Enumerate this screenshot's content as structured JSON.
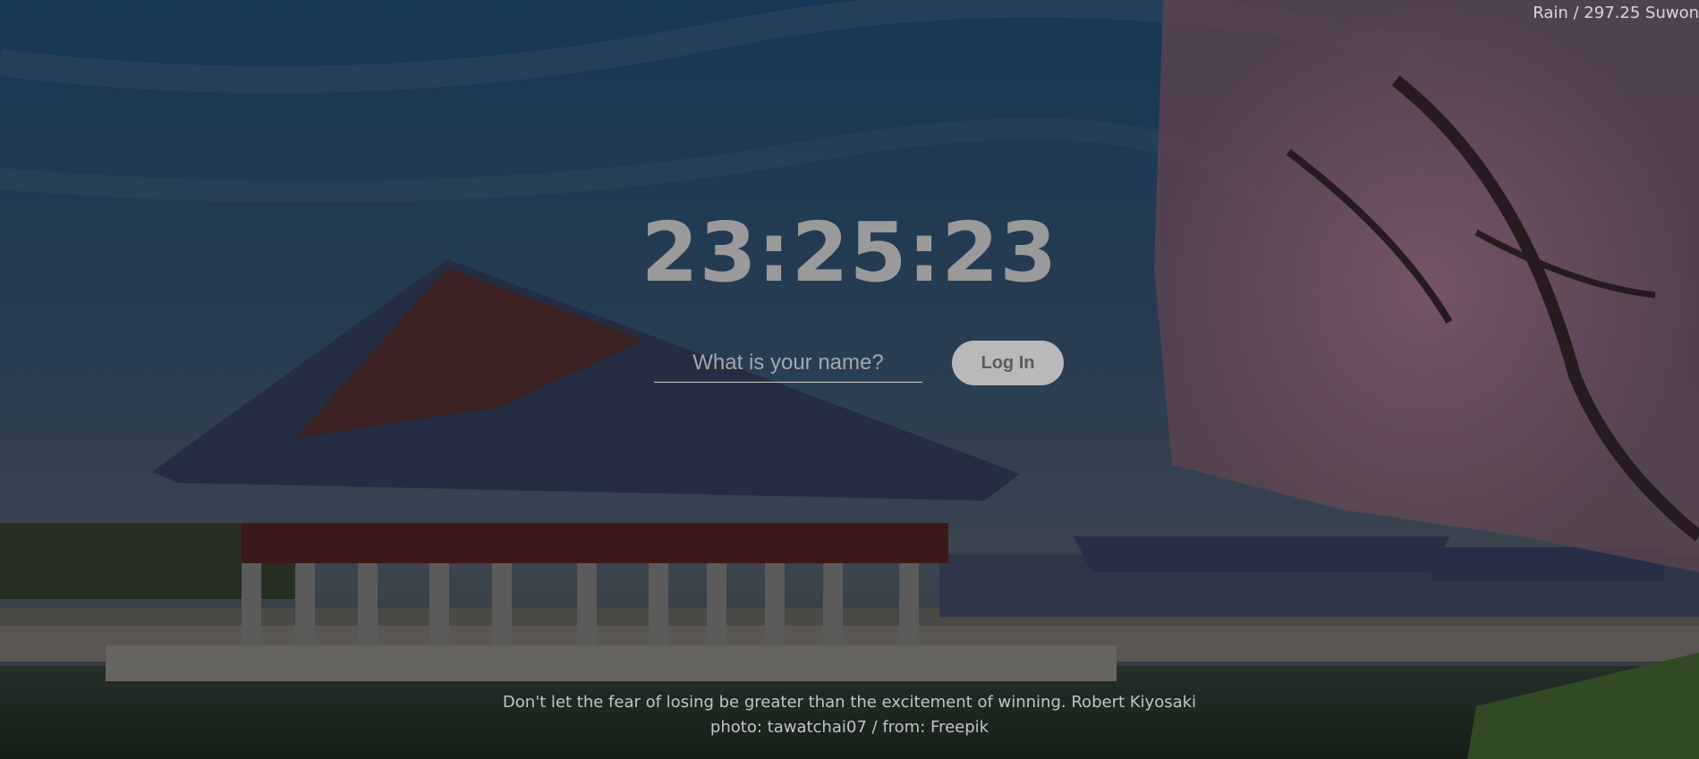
{
  "weather": {
    "text": "Rain / 297.25 Suwon"
  },
  "clock": {
    "time": "23:25:23"
  },
  "login": {
    "placeholder": "What is your name?",
    "button_label": "Log In"
  },
  "quote": {
    "text": "Don't let the fear of losing be greater than the excitement of winning.",
    "author": "Robert Kiyosaki"
  },
  "photo_credit": {
    "photo_label": "photo:",
    "photographer": "tawatchai07",
    "separator": "/",
    "from_label": "from:",
    "source": "Freepik"
  },
  "colors": {
    "overlay": "#000000",
    "clock": "#9a9a9a",
    "button_bg": "#b9b9b9",
    "button_text": "#5b5b5b"
  }
}
